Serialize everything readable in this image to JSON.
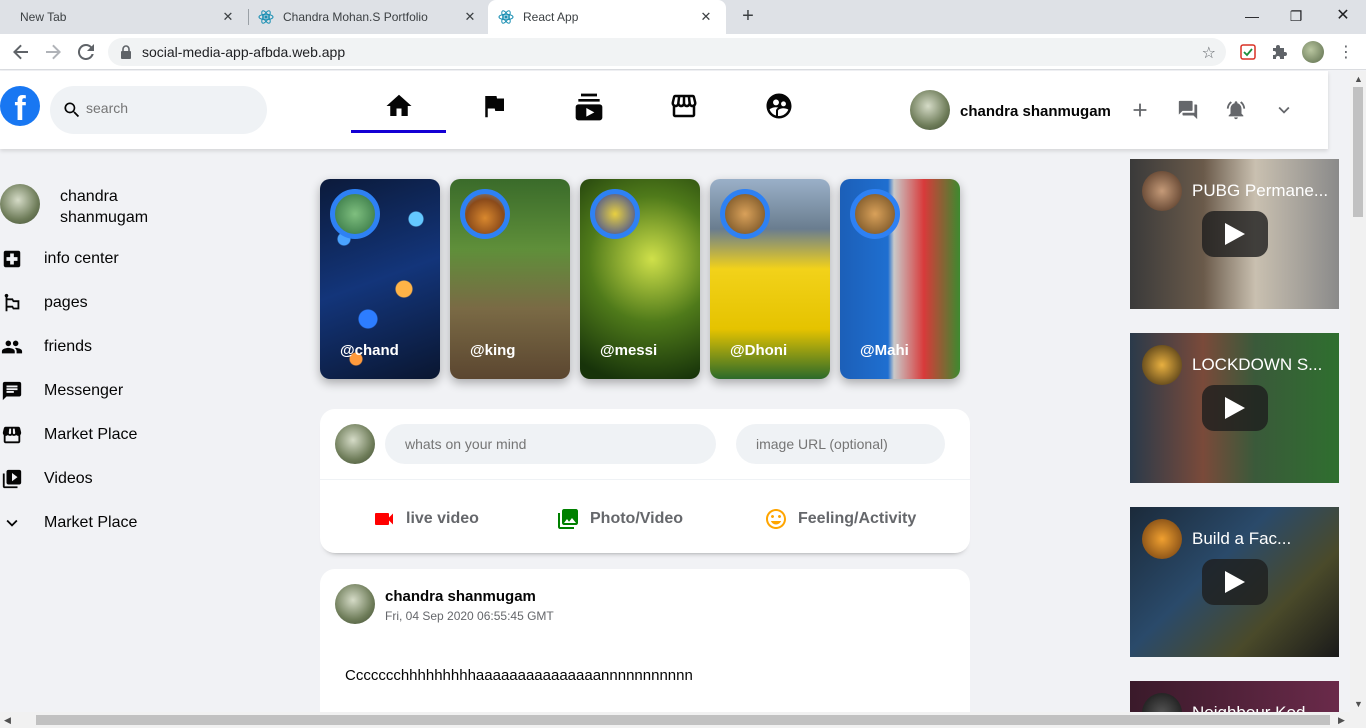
{
  "browser": {
    "tabs": [
      {
        "title": "New Tab",
        "active": false
      },
      {
        "title": "Chandra Mohan.S Portfolio",
        "active": false
      },
      {
        "title": "React App",
        "active": true
      }
    ],
    "url": "social-media-app-afbda.web.app"
  },
  "header": {
    "logo": "f",
    "search_placeholder": "search",
    "nav_icons": [
      "home-icon",
      "flag-icon",
      "subscriptions-icon",
      "storefront-icon",
      "supervised-user-icon"
    ],
    "active_nav": "home-icon",
    "user_name": "chandra shanmugam",
    "right_icons": [
      "add-icon",
      "forum-icon",
      "notifications-active-icon",
      "expand-more-icon"
    ],
    "accent_color": "#1400d4"
  },
  "sidebar": {
    "user_name": "chandra shanmugam",
    "items": [
      {
        "label": "info center",
        "icon": "local-hospital-icon"
      },
      {
        "label": "pages",
        "icon": "emoji-flags-icon"
      },
      {
        "label": "friends",
        "icon": "people-icon"
      },
      {
        "label": "Messenger",
        "icon": "chat-icon"
      },
      {
        "label": "Market Place",
        "icon": "storefront-icon"
      },
      {
        "label": "Videos",
        "icon": "video-library-icon"
      },
      {
        "label": "Market Place",
        "icon": "expand-more-icon"
      }
    ]
  },
  "stories": [
    {
      "label": "@chand"
    },
    {
      "label": "@king"
    },
    {
      "label": "@messi"
    },
    {
      "label": "@Dhoni"
    },
    {
      "label": "@Mahi"
    }
  ],
  "composer": {
    "message_placeholder": "whats on your mind",
    "image_placeholder": "image URL (optional)",
    "options": [
      {
        "label": "live video",
        "icon": "videocam-icon",
        "color": "#ff0000"
      },
      {
        "label": "Photo/Video",
        "icon": "photo-library-icon",
        "color": "#008000"
      },
      {
        "label": "Feeling/Activity",
        "icon": "insert-emoticon-icon",
        "color": "#ffa500"
      }
    ]
  },
  "post": {
    "user_name": "chandra shanmugam",
    "timestamp": "Fri, 04 Sep 2020 06:55:45 GMT",
    "message": "Ccccccchhhhhhhhhaaaaaaaaaaaaaaannnnnnnnnnn"
  },
  "videos": [
    {
      "title": "PUBG Permane..."
    },
    {
      "title": "LOCKDOWN S..."
    },
    {
      "title": "Build a Fac..."
    },
    {
      "title": "Neighbour Kod..."
    }
  ]
}
